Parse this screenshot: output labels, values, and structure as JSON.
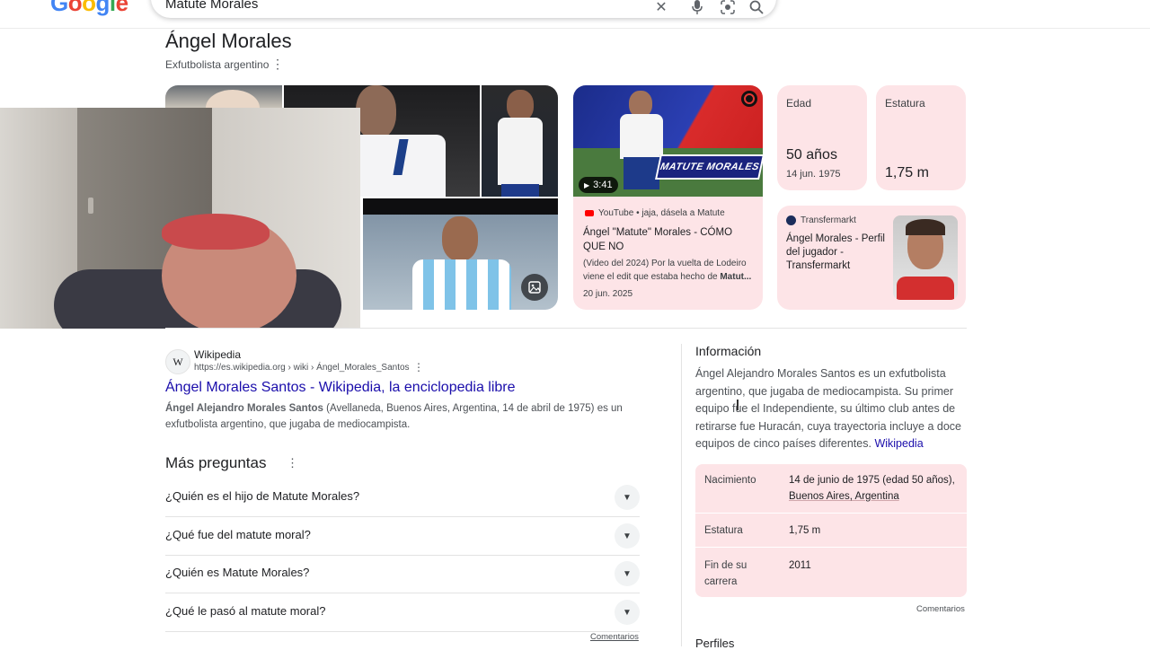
{
  "header": {
    "logo_letters": [
      "G",
      "o",
      "o",
      "g",
      "l",
      "e"
    ],
    "search_value": "Matute Morales",
    "icons": [
      "close-icon",
      "microphone-icon",
      "lens-icon",
      "search-icon"
    ]
  },
  "entity": {
    "title": "Ángel Morales",
    "subtitle": "Exfutbolista argentino"
  },
  "video": {
    "duration": "3:41",
    "overlay_text": "MATUTE MORALES",
    "source": "YouTube • jaja, dásela a Matute",
    "title": "Ángel \"Matute\" Morales - CÓMO QUE NO",
    "snippet_start": "(Video del 2024) Por la vuelta de Lodeiro viene el edit que estaba hecho de ",
    "snippet_bold": "Matut...",
    "date": "20 jun. 2025"
  },
  "age_card": {
    "label": "Edad",
    "value": "50 años",
    "detail": "14 jun. 1975"
  },
  "height_card": {
    "label": "Estatura",
    "value": "1,75 m"
  },
  "transfermarkt": {
    "source": "Transfermarkt",
    "title": "Ángel Morales - Perfil del jugador - Transfermarkt"
  },
  "result": {
    "site_name": "Wikipedia",
    "favicon": "W",
    "url": "https://es.wikipedia.org › wiki › Ángel_Morales_Santos",
    "title": "Ángel Morales Santos - Wikipedia, la enciclopedia libre",
    "snippet_bold": "Ángel Alejandro Morales Santos",
    "snippet_rest": " (Avellaneda, Buenos Aires, Argentina, 14 de abril de 1975) es un exfutbolista argentino, que jugaba de mediocampista."
  },
  "paa": {
    "heading": "Más preguntas",
    "questions": [
      "¿Quién es el hijo de Matute Morales?",
      "¿Qué fue del matute moral?",
      "¿Quién es Matute Morales?",
      "¿Qué le pasó al matute moral?"
    ],
    "feedback": "Comentarios"
  },
  "info": {
    "heading": "Información",
    "description": "Ángel Alejandro Morales Santos es un exfutbolista argentino, que jugaba de mediocampista. Su primer equipo fue el Independiente, su último club antes de retirarse fue Huracán, cuya trayectoria incluye a doce equipos de cinco países diferentes.",
    "source_link": "Wikipedia",
    "rows": [
      {
        "key": "Nacimiento",
        "value": "14 de junio de 1975 (edad 50 años),",
        "value_link": "Buenos Aires, Argentina"
      },
      {
        "key": "Estatura",
        "value": "1,75 m"
      },
      {
        "key": "Fin de su carrera",
        "value": "2011"
      }
    ],
    "feedback": "Comentarios",
    "next_heading": "Perfiles"
  },
  "colors": {
    "pink_card": "#fde4e7",
    "link": "#1a0dab",
    "wiki_link": "#1a0dab"
  }
}
